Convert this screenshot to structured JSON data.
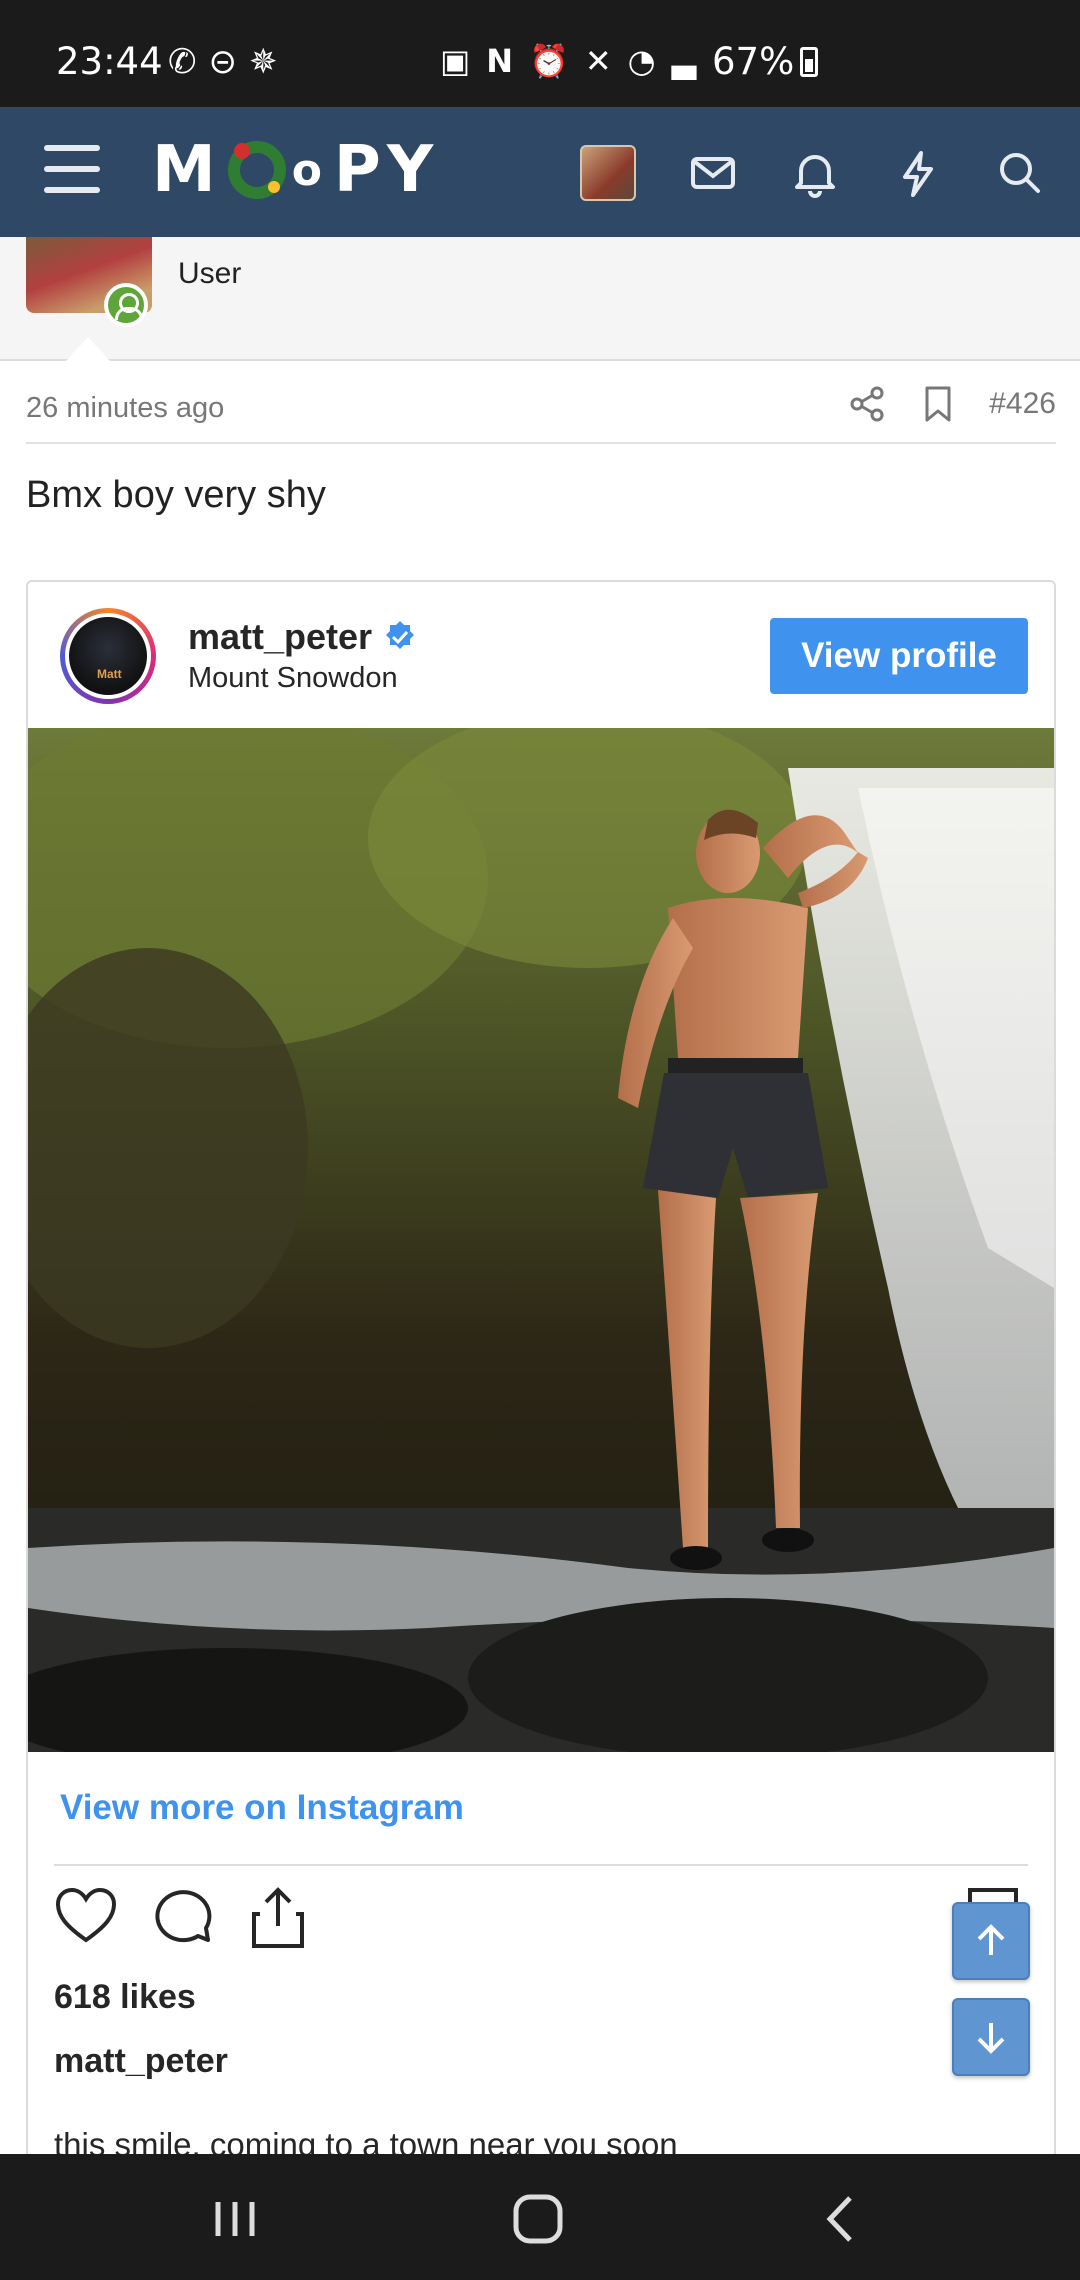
{
  "status_bar": {
    "time": "23:44",
    "left_icons": [
      "whatsapp-icon",
      "do-not-disturb-icon",
      "sparkle-icon"
    ],
    "right_icons": [
      "battery-saver-icon",
      "nfc-icon",
      "alarm-icon",
      "mute-icon",
      "wifi-icon",
      "signal-icon"
    ],
    "battery": "67%"
  },
  "header": {
    "logo": {
      "prefix": "M",
      "small": "o",
      "suffix": "PY"
    },
    "icons": [
      "menu-icon",
      "user-avatar",
      "mail-icon",
      "bell-icon",
      "lightning-icon",
      "search-icon"
    ]
  },
  "user": {
    "role": "User",
    "status": "online"
  },
  "post": {
    "time": "26 minutes ago",
    "number": "#426",
    "text": "Bmx boy very shy"
  },
  "instagram": {
    "username": "matt_peter",
    "verified": true,
    "location": "Mount Snowdon",
    "view_profile_label": "View profile",
    "view_more_label": "View more on Instagram",
    "likes": "618 likes",
    "caption_user": "matt_peter",
    "caption": "this smile, coming to a town near you soon"
  },
  "colors": {
    "header_bg": "#2f4866",
    "accent_blue": "#3f93ee",
    "scroll_button": "#5f95d0",
    "online_green": "#5fa53a"
  }
}
